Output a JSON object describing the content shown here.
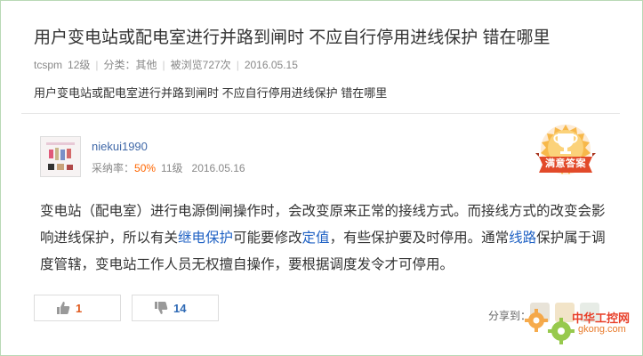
{
  "question": {
    "title": "用户变电站或配电室进行并路到闸时 不应自行停用进线保护 错在哪里",
    "author": "tcspm",
    "level": "12级",
    "category_label": "分类：",
    "category": "其他",
    "views": "被浏览727次",
    "date": "2016.05.15",
    "body": "用户变电站或配电室进行并路到闸时 不应自行停用进线保护 错在哪里"
  },
  "answer": {
    "user": "niekui1990",
    "rate_label": "采纳率：",
    "rate": "50%",
    "level": "11级",
    "date": "2016.05.16",
    "badge": "满意答案",
    "text_1": "变电站（配电室）进行电源倒闸操作时，会改变原来正常的接线方式。而接线方式的改变会影响进线保护，所以有关",
    "link_1": "继电保护",
    "text_2": "可能要修改",
    "link_2": "定值",
    "text_3": "，有些保护要及时停用。通常",
    "link_3": "线路",
    "text_4": "保护属于调度管辖，变电站工作人员无权擅自操作，要根据调度发令才可停用。"
  },
  "votes": {
    "up": "1",
    "down": "14"
  },
  "share": {
    "label": "分享到："
  },
  "watermark": {
    "name": "中华工控网",
    "url": "gkong.com"
  },
  "colors": {
    "border": "#b9d9b5",
    "link": "#2062c4",
    "rate": "#ff6600",
    "up": "#e05a1e",
    "down": "#2f6ab5"
  }
}
